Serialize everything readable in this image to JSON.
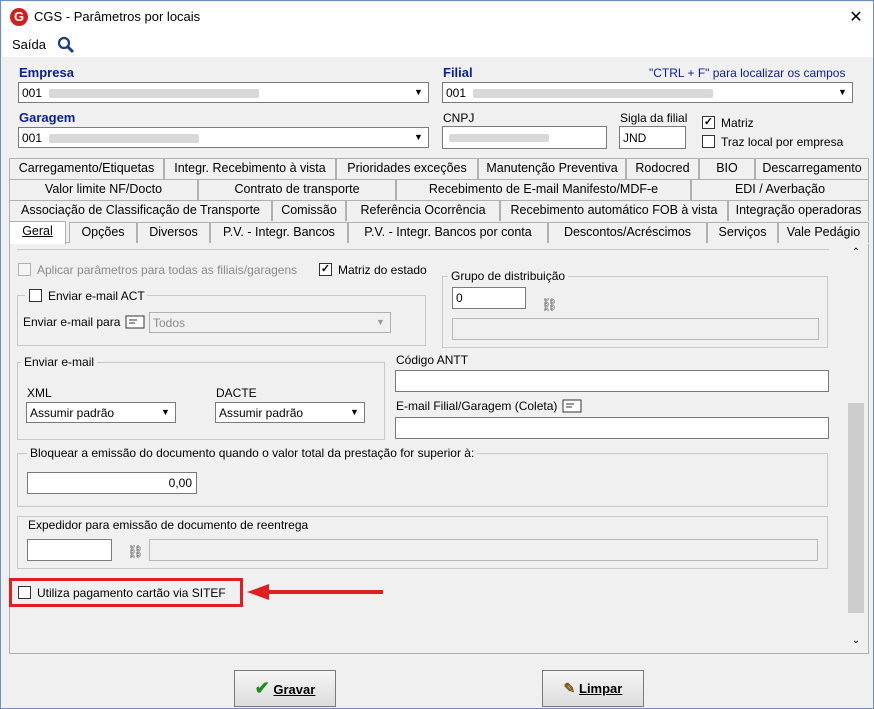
{
  "window": {
    "title": "CGS - Parâmetros por locais",
    "close_glyph": "✕",
    "logo_letter": "G"
  },
  "menu": {
    "exit_label": "Saída"
  },
  "header": {
    "empresa_label": "Empresa",
    "empresa_value": "001",
    "filial_label": "Filial",
    "filial_value": "001",
    "find_hint": "\"CTRL + F\" para localizar os campos",
    "garagem_label": "Garagem",
    "garagem_value": "001",
    "cnpj_label": "CNPJ",
    "sigla_label": "Sigla da filial",
    "sigla_value": "JND",
    "matriz_label": "Matriz",
    "traz_local_label": "Traz local por empresa"
  },
  "tabs": {
    "row1": [
      "Carregamento/Etiquetas",
      "Integr. Recebimento à vista",
      "Prioridades exceções",
      "Manutenção Preventiva",
      "Rodocred",
      "BIO",
      "Descarregamento"
    ],
    "row2": [
      "Valor limite NF/Docto",
      "Contrato de transporte",
      "Recebimento de E-mail Manifesto/MDF-e",
      "EDI / Averbação"
    ],
    "row3": [
      "Associação de Classificação de Transporte",
      "Comissão",
      "Referência Ocorrência",
      "Recebimento automático FOB à vista",
      "Integração operadoras"
    ],
    "row4": [
      "Geral",
      "Opções",
      "Diversos",
      "P.V. - Integr. Bancos",
      "P.V. - Integr. Bancos por conta",
      "Descontos/Acréscimos",
      "Serviços",
      "Vale Pedágio"
    ]
  },
  "form": {
    "aplicar_label": "Aplicar parâmetros para todas as filiais/garagens",
    "matriz_estado_label": "Matriz do estado",
    "grupo_label": "Grupo de distribuição",
    "grupo_value": "0",
    "enviar_act_label": "Enviar e-mail ACT",
    "enviar_para_label": "Enviar e-mail para",
    "enviar_para_value": "Todos",
    "enviar_email_group": "Enviar e-mail",
    "xml_label": "XML",
    "xml_value": "Assumir padrão",
    "dacte_label": "DACTE",
    "dacte_value": "Assumir padrão",
    "antt_label": "Código ANTT",
    "email_filial_label": "E-mail Filial/Garagem (Coleta)",
    "bloquear_label": "Bloquear a emissão do documento quando o valor total da prestação for superior à:",
    "bloquear_value": "0,00",
    "expedidor_label": "Expedidor para emissão de documento de reentrega",
    "sitef_label": "Utiliza pagamento cartão via SITEF"
  },
  "buttons": {
    "save": "Gravar",
    "clear": "Limpar"
  },
  "colors": {
    "annotation": "#e02020",
    "label_blue": "#0b1f8f"
  }
}
